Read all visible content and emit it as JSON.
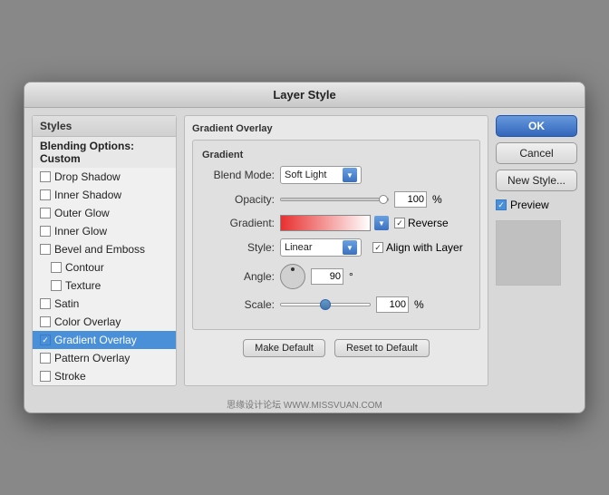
{
  "dialog": {
    "title": "Layer Style"
  },
  "left_panel": {
    "title": "Styles",
    "items": [
      {
        "id": "blending-options",
        "label": "Blending Options: Custom",
        "type": "header",
        "checked": false
      },
      {
        "id": "drop-shadow",
        "label": "Drop Shadow",
        "type": "checkbox",
        "checked": false
      },
      {
        "id": "inner-shadow",
        "label": "Inner Shadow",
        "type": "checkbox",
        "checked": false
      },
      {
        "id": "outer-glow",
        "label": "Outer Glow",
        "type": "checkbox",
        "checked": false
      },
      {
        "id": "inner-glow",
        "label": "Inner Glow",
        "type": "checkbox",
        "checked": false
      },
      {
        "id": "bevel-emboss",
        "label": "Bevel and Emboss",
        "type": "checkbox",
        "checked": false
      },
      {
        "id": "contour",
        "label": "Contour",
        "type": "checkbox-indent",
        "checked": false
      },
      {
        "id": "texture",
        "label": "Texture",
        "type": "checkbox-indent",
        "checked": false
      },
      {
        "id": "satin",
        "label": "Satin",
        "type": "checkbox",
        "checked": false
      },
      {
        "id": "color-overlay",
        "label": "Color Overlay",
        "type": "checkbox",
        "checked": false
      },
      {
        "id": "gradient-overlay",
        "label": "Gradient Overlay",
        "type": "checkbox",
        "checked": true,
        "selected": true
      },
      {
        "id": "pattern-overlay",
        "label": "Pattern Overlay",
        "type": "checkbox",
        "checked": false
      },
      {
        "id": "stroke",
        "label": "Stroke",
        "type": "checkbox",
        "checked": false
      }
    ]
  },
  "main_panel": {
    "section_title": "Gradient Overlay",
    "inner_title": "Gradient",
    "fields": {
      "blend_mode": {
        "label": "Blend Mode:",
        "value": "Soft Light"
      },
      "opacity": {
        "label": "Opacity:",
        "value": "100",
        "unit": "%",
        "slider_pct": 100
      },
      "gradient": {
        "label": "Gradient:"
      },
      "reverse_label": "Reverse",
      "style": {
        "label": "Style:",
        "value": "Linear"
      },
      "align_with_layer_label": "Align with Layer",
      "angle": {
        "label": "Angle:",
        "value": "90",
        "unit": "°"
      },
      "scale": {
        "label": "Scale:",
        "value": "100",
        "unit": "%",
        "slider_pct": 50
      }
    },
    "buttons": {
      "make_default": "Make Default",
      "reset_to_default": "Reset to Default"
    }
  },
  "right_panel": {
    "ok_label": "OK",
    "cancel_label": "Cancel",
    "new_style_label": "New Style...",
    "preview_label": "Preview"
  },
  "watermark": "思缘设计论坛 WWW.MISSVUAN.COM"
}
